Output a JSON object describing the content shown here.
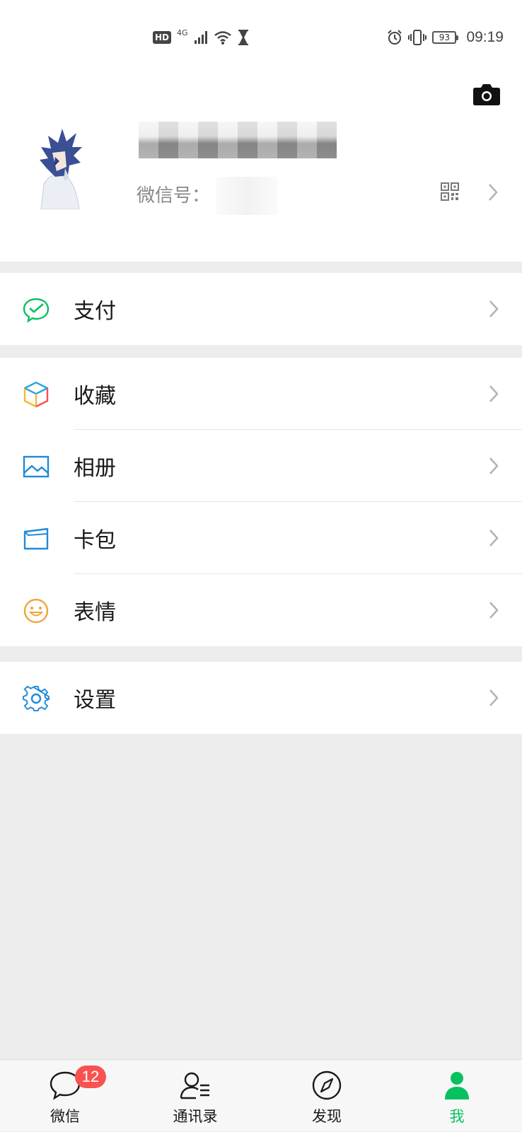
{
  "status_bar": {
    "hd": "HD",
    "network": "4G",
    "battery": "93",
    "time": "09:19"
  },
  "profile": {
    "wechat_id_label": "微信号："
  },
  "menu": {
    "pay": "支付",
    "favorites": "收藏",
    "album": "相册",
    "card_pack": "卡包",
    "stickers": "表情",
    "settings": "设置"
  },
  "tabbar": {
    "chats": "微信",
    "chats_badge": "12",
    "contacts": "通讯录",
    "discover": "发现",
    "me": "我"
  },
  "colors": {
    "accent": "#07c160",
    "badge": "#fa5151",
    "background": "#ededed"
  }
}
